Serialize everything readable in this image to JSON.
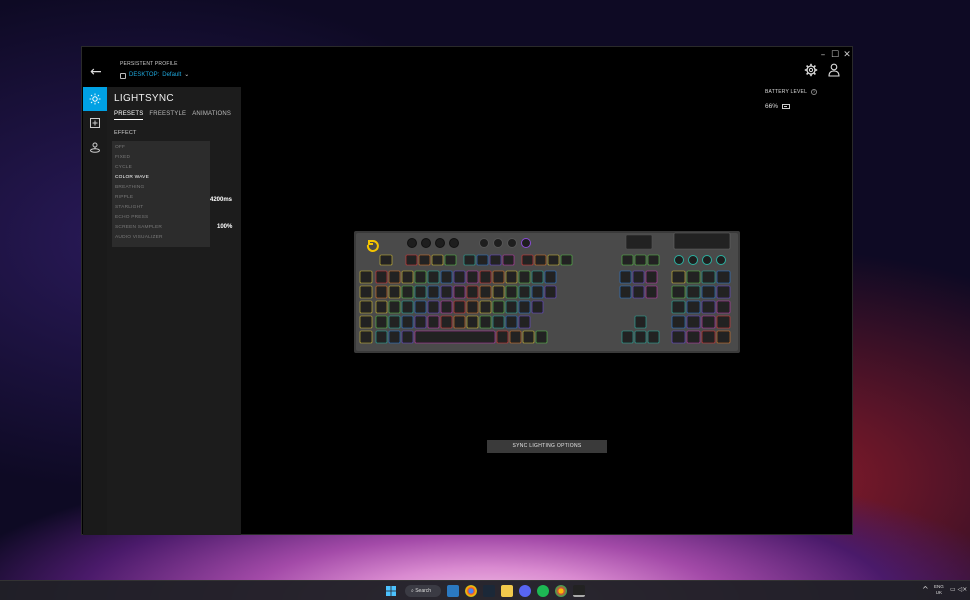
{
  "window": {
    "controls": {
      "minimize": "–",
      "maximize": "☐",
      "close": "✕"
    },
    "back_icon": "←"
  },
  "profile": {
    "label": "PERSISTENT PROFILE",
    "name_prefix": "DESKTOP:",
    "name_value": "Default",
    "chevron": "⌄"
  },
  "rail": {
    "items": [
      {
        "name": "lightsync",
        "icon": "sun-icon",
        "active": true
      },
      {
        "name": "assignments",
        "icon": "plus-square-icon",
        "active": false
      },
      {
        "name": "game-mode",
        "icon": "joystick-icon",
        "active": false
      }
    ]
  },
  "panel": {
    "title": "LIGHTSYNC",
    "tabs": [
      "PRESETS",
      "FREESTYLE",
      "ANIMATIONS"
    ],
    "active_tab": 0,
    "effect_label": "EFFECT",
    "effects": [
      "OFF",
      "FIXED",
      "CYCLE",
      "COLOR WAVE",
      "BREATHING",
      "RIPPLE",
      "STARLIGHT",
      "ECHO PRESS",
      "SCREEN SAMPLER",
      "AUDIO VISUALIZER"
    ],
    "selected_effect": "COLOR WAVE",
    "speed_value": "4200ms",
    "brightness_value": "100%"
  },
  "battery": {
    "label": "BATTERY LEVEL",
    "help": "?",
    "value": "66%"
  },
  "sync_button": "SYNC LIGHTING OPTIONS",
  "taskbar": {
    "search_label": "Search",
    "lang_line1": "ENG",
    "lang_line2": "UK",
    "chevron": "^",
    "tray": "▭ ◁×"
  },
  "colors": {
    "accent": "#00a1e4",
    "accent_text": "#1ea7dc",
    "logo_yellow": "#f5c400"
  }
}
